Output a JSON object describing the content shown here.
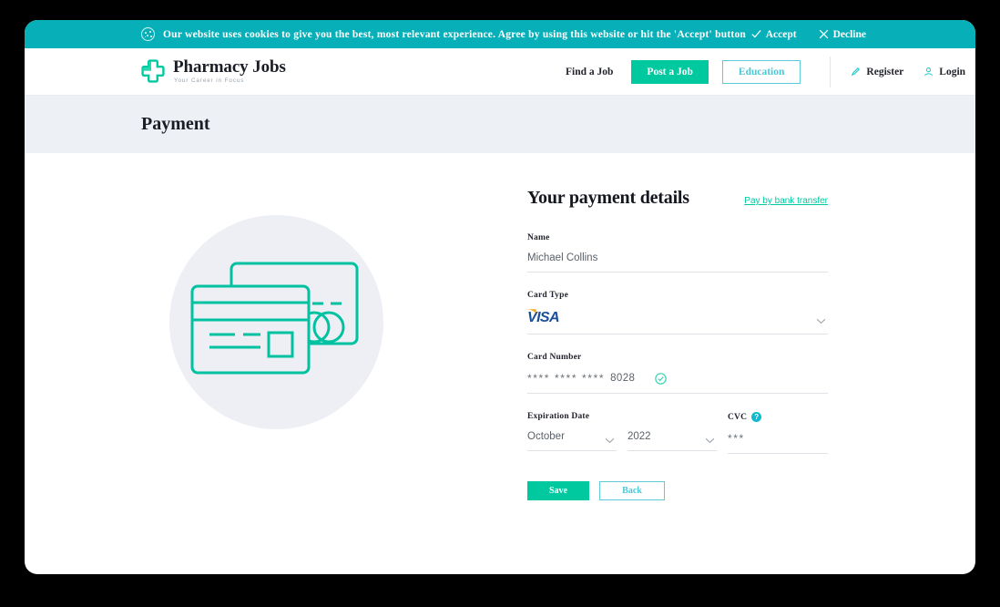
{
  "cookie_bar": {
    "icon": "cookie-icon",
    "message": "Our website uses cookies to give you the best, most relevant experience. Agree by using this website or hit the 'Accept' button",
    "accept_label": "Accept",
    "accept_icon": "check-icon",
    "decline_label": "Decline",
    "decline_icon": "close-icon",
    "background_color": "#07B0B8"
  },
  "header": {
    "logo": {
      "icon": "pharmacy-cross-icon",
      "title": "Pharmacy Jobs",
      "tagline": "Your Career in Focus"
    },
    "nav": {
      "find_a_job": "Find a Job",
      "post_a_job": "Post a Job",
      "education": "Education",
      "register": "Register",
      "register_icon": "pencil-icon",
      "login": "Login",
      "login_icon": "user-icon"
    }
  },
  "page": {
    "title": "Payment",
    "band_color": "#EDF0F5"
  },
  "illustration": {
    "icon": "credit-cards-icon",
    "circle_color": "#EDEFF4",
    "stroke_color": "#00C2A0"
  },
  "form": {
    "heading": "Your payment details",
    "bank_transfer_link": "Pay by bank transfer",
    "name": {
      "label": "Name",
      "value": "Michael Collins"
    },
    "card_type": {
      "label": "Card Type",
      "value": "VISA",
      "chevron_icon": "chevron-down-icon"
    },
    "card_number": {
      "label": "Card Number",
      "masked": "**** **** ****",
      "last4": "8028",
      "valid_icon": "check-circle-icon"
    },
    "expiration": {
      "label": "Expiration Date",
      "month": "October",
      "year": "2022",
      "chevron_icon": "chevron-down-icon"
    },
    "cvc": {
      "label": "CVC",
      "help_icon": "question-mark-icon",
      "value": "***"
    },
    "save_label": "Save",
    "back_label": "Back"
  },
  "theme": {
    "teal": "#00C9A0",
    "cyan": "#07B0B8",
    "outline_blue": "#5ECAD8",
    "visa_blue": "#1A4F9C",
    "visa_gold": "#F6A623"
  }
}
